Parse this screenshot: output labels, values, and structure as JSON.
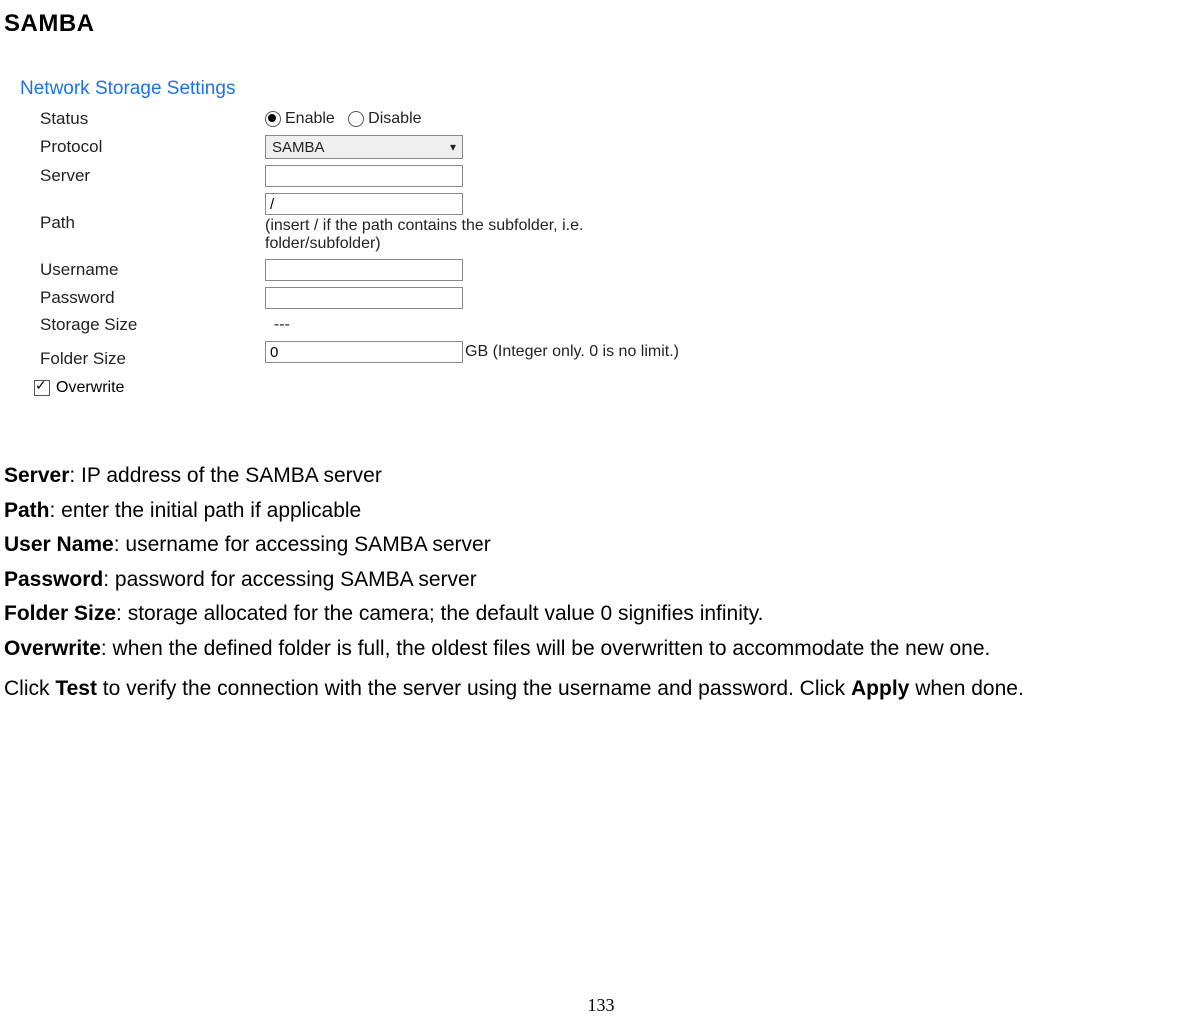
{
  "heading": "SAMBA",
  "panel": {
    "title": "Network Storage Settings",
    "status_label": "Status",
    "enable": "Enable",
    "disable": "Disable",
    "protocol_label": "Protocol",
    "protocol_value": "SAMBA",
    "server_label": "Server",
    "server_value": "",
    "path_label": "Path",
    "path_value": "/",
    "path_hint": "(insert / if the path contains the subfolder, i.e. folder/subfolder)",
    "username_label": "Username",
    "username_value": "",
    "password_label": "Password",
    "password_value": "",
    "storage_size_label": "Storage Size",
    "storage_size_value": "---",
    "folder_size_label": "Folder Size",
    "folder_size_value": "0",
    "folder_size_hint": "GB (Integer only. 0 is no limit.)",
    "overwrite_label": "Overwrite"
  },
  "desc": {
    "server_key": "Server",
    "server_txt": ": IP address of the SAMBA server",
    "path_key": "Path",
    "path_txt": ": enter the initial path if applicable",
    "user_key": "User Name",
    "user_txt": ": username for accessing SAMBA server",
    "pass_key": "Password",
    "pass_txt": ": password for accessing SAMBA server",
    "folder_key": "Folder Size",
    "folder_txt": ": storage allocated for the camera; the default value 0 signifies infinity.",
    "over_key": "Overwrite",
    "over_txt": ": when the defined folder is full, the oldest files will be overwritten to accommodate the new one.",
    "final_pre": "Click ",
    "final_test": "Test",
    "final_mid": " to verify the connection with the server using the username and password. Click ",
    "final_apply": "Apply",
    "final_post": " when done."
  },
  "page_number": "133"
}
